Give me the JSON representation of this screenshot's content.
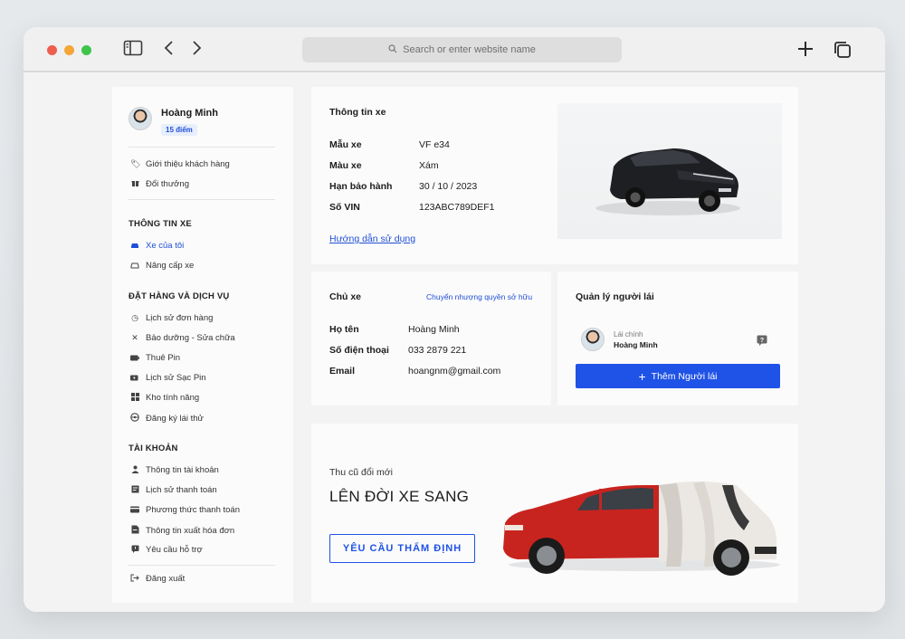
{
  "browser": {
    "url_placeholder": "Search or enter website name"
  },
  "profile": {
    "name": "Hoàng Minh",
    "points": "15 điểm"
  },
  "sidebar": {
    "top_items": [
      {
        "label": "Giới thiệu khách hàng",
        "icon": "tag-icon"
      },
      {
        "label": "Đổi thưởng",
        "icon": "gift-icon"
      }
    ],
    "sections": [
      {
        "title": "THÔNG TIN XE",
        "items": [
          {
            "label": "Xe của tôi",
            "icon": "car-icon",
            "active": true
          },
          {
            "label": "Nâng cấp xe",
            "icon": "car-upgrade-icon"
          }
        ]
      },
      {
        "title": "ĐẶT HÀNG VÀ DỊCH VỤ",
        "items": [
          {
            "label": "Lịch sử đơn hàng",
            "icon": "history-icon"
          },
          {
            "label": "Bảo dưỡng - Sửa chữa",
            "icon": "wrench-icon"
          },
          {
            "label": "Thuê Pin",
            "icon": "battery-icon"
          },
          {
            "label": "Lịch sử Sạc Pin",
            "icon": "charge-icon"
          },
          {
            "label": "Kho tính năng",
            "icon": "grid-icon"
          },
          {
            "label": "Đăng ký lái thử",
            "icon": "steering-icon"
          }
        ]
      },
      {
        "title": "TÀI KHOẢN",
        "items": [
          {
            "label": "Thông tin tài khoản",
            "icon": "user-icon"
          },
          {
            "label": "Lịch sử thanh toán",
            "icon": "receipt-icon"
          },
          {
            "label": "Phương thức thanh toán",
            "icon": "card-icon"
          },
          {
            "label": "Thông tin xuất hóa đơn",
            "icon": "invoice-icon"
          },
          {
            "label": "Yêu cầu hỗ trợ",
            "icon": "support-icon"
          }
        ]
      }
    ],
    "logout": "Đăng xuất"
  },
  "vehicle_info": {
    "title": "Thông tin xe",
    "rows": [
      {
        "key": "Mẫu xe",
        "value": "VF e34"
      },
      {
        "key": "Màu xe",
        "value": "Xám"
      },
      {
        "key": "Hạn bảo hành",
        "value": "30 / 10 / 2023"
      },
      {
        "key": "Số VIN",
        "value": "123ABC789DEF1"
      }
    ],
    "guide_link": "Hướng dẫn sử dụng"
  },
  "owner": {
    "title": "Chủ xe",
    "transfer_link": "Chuyển nhượng quyền sở hữu",
    "rows": [
      {
        "key": "Họ tên",
        "value": "Hoàng Minh"
      },
      {
        "key": "Số điện thoại",
        "value": "033 2879 221"
      },
      {
        "key": "Email",
        "value": "hoangnm@gmail.com"
      }
    ]
  },
  "drivers": {
    "title": "Quản lý người lái",
    "driver_role": "Lái chính",
    "driver_name": "Hoàng Minh",
    "add_button": "Thêm Người lái"
  },
  "promo": {
    "subtitle": "Thu cũ đổi mới",
    "headline": "LÊN ĐỜI XE SANG",
    "button": "YÊU CẦU THẨM ĐỊNH"
  }
}
